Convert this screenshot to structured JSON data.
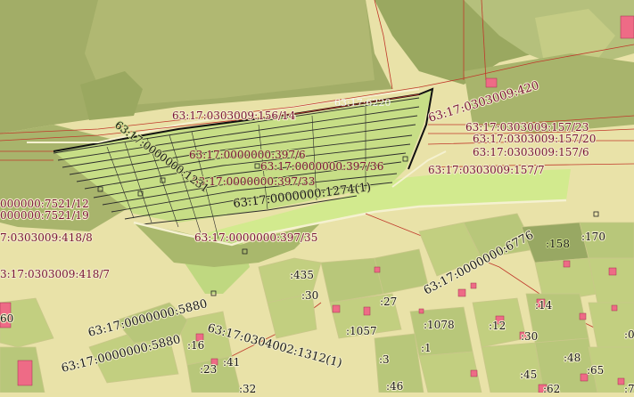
{
  "map": {
    "colors": {
      "background": "#e9e2a8",
      "green_dark": "#9aa860",
      "green_olive": "#a8b46c",
      "green_light": "#c7de86",
      "green_bright": "#d2ea8e",
      "building": "#ee6b86",
      "boundary_red": "#c0392b",
      "label_maroon": "#7a1537",
      "label_dark": "#1a1a1a"
    },
    "parcel_labels": [
      "63:17:0303009:156/14",
      "63:17:6220",
      "63:17:0303009:420",
      "63:17:0303009:157/23",
      "63:17:0303009:157/20",
      "63:17:0303009:157/6",
      "63:17:0303009:157/7",
      "63:17:0000000:397/6",
      "63:17:0000000:397/36",
      "63:17:0000000:397/33",
      "63:17:0000000:1274(1)",
      "63:17:0000000:397/35",
      "000000:7521/12",
      "000000:7521/19",
      "7:0303009:418/8",
      "3:17:0303009:418/7",
      "63:17:0000000:6776",
      "63:17:0000000:5880",
      "63:17:0000000:5880",
      "63:17:0304002:1312(1)",
      "63:17:0000000:1231"
    ],
    "short_labels": [
      ":158",
      ":170",
      ":435",
      ":30",
      ":27",
      ":1078",
      ":12",
      ":14",
      ":1057",
      ":1",
      ":30",
      ":16",
      ":41",
      ":23",
      ":3",
      ":48",
      ":65",
      ":46",
      ":62",
      ":45",
      ":32",
      ":0",
      ":7",
      "60"
    ]
  }
}
